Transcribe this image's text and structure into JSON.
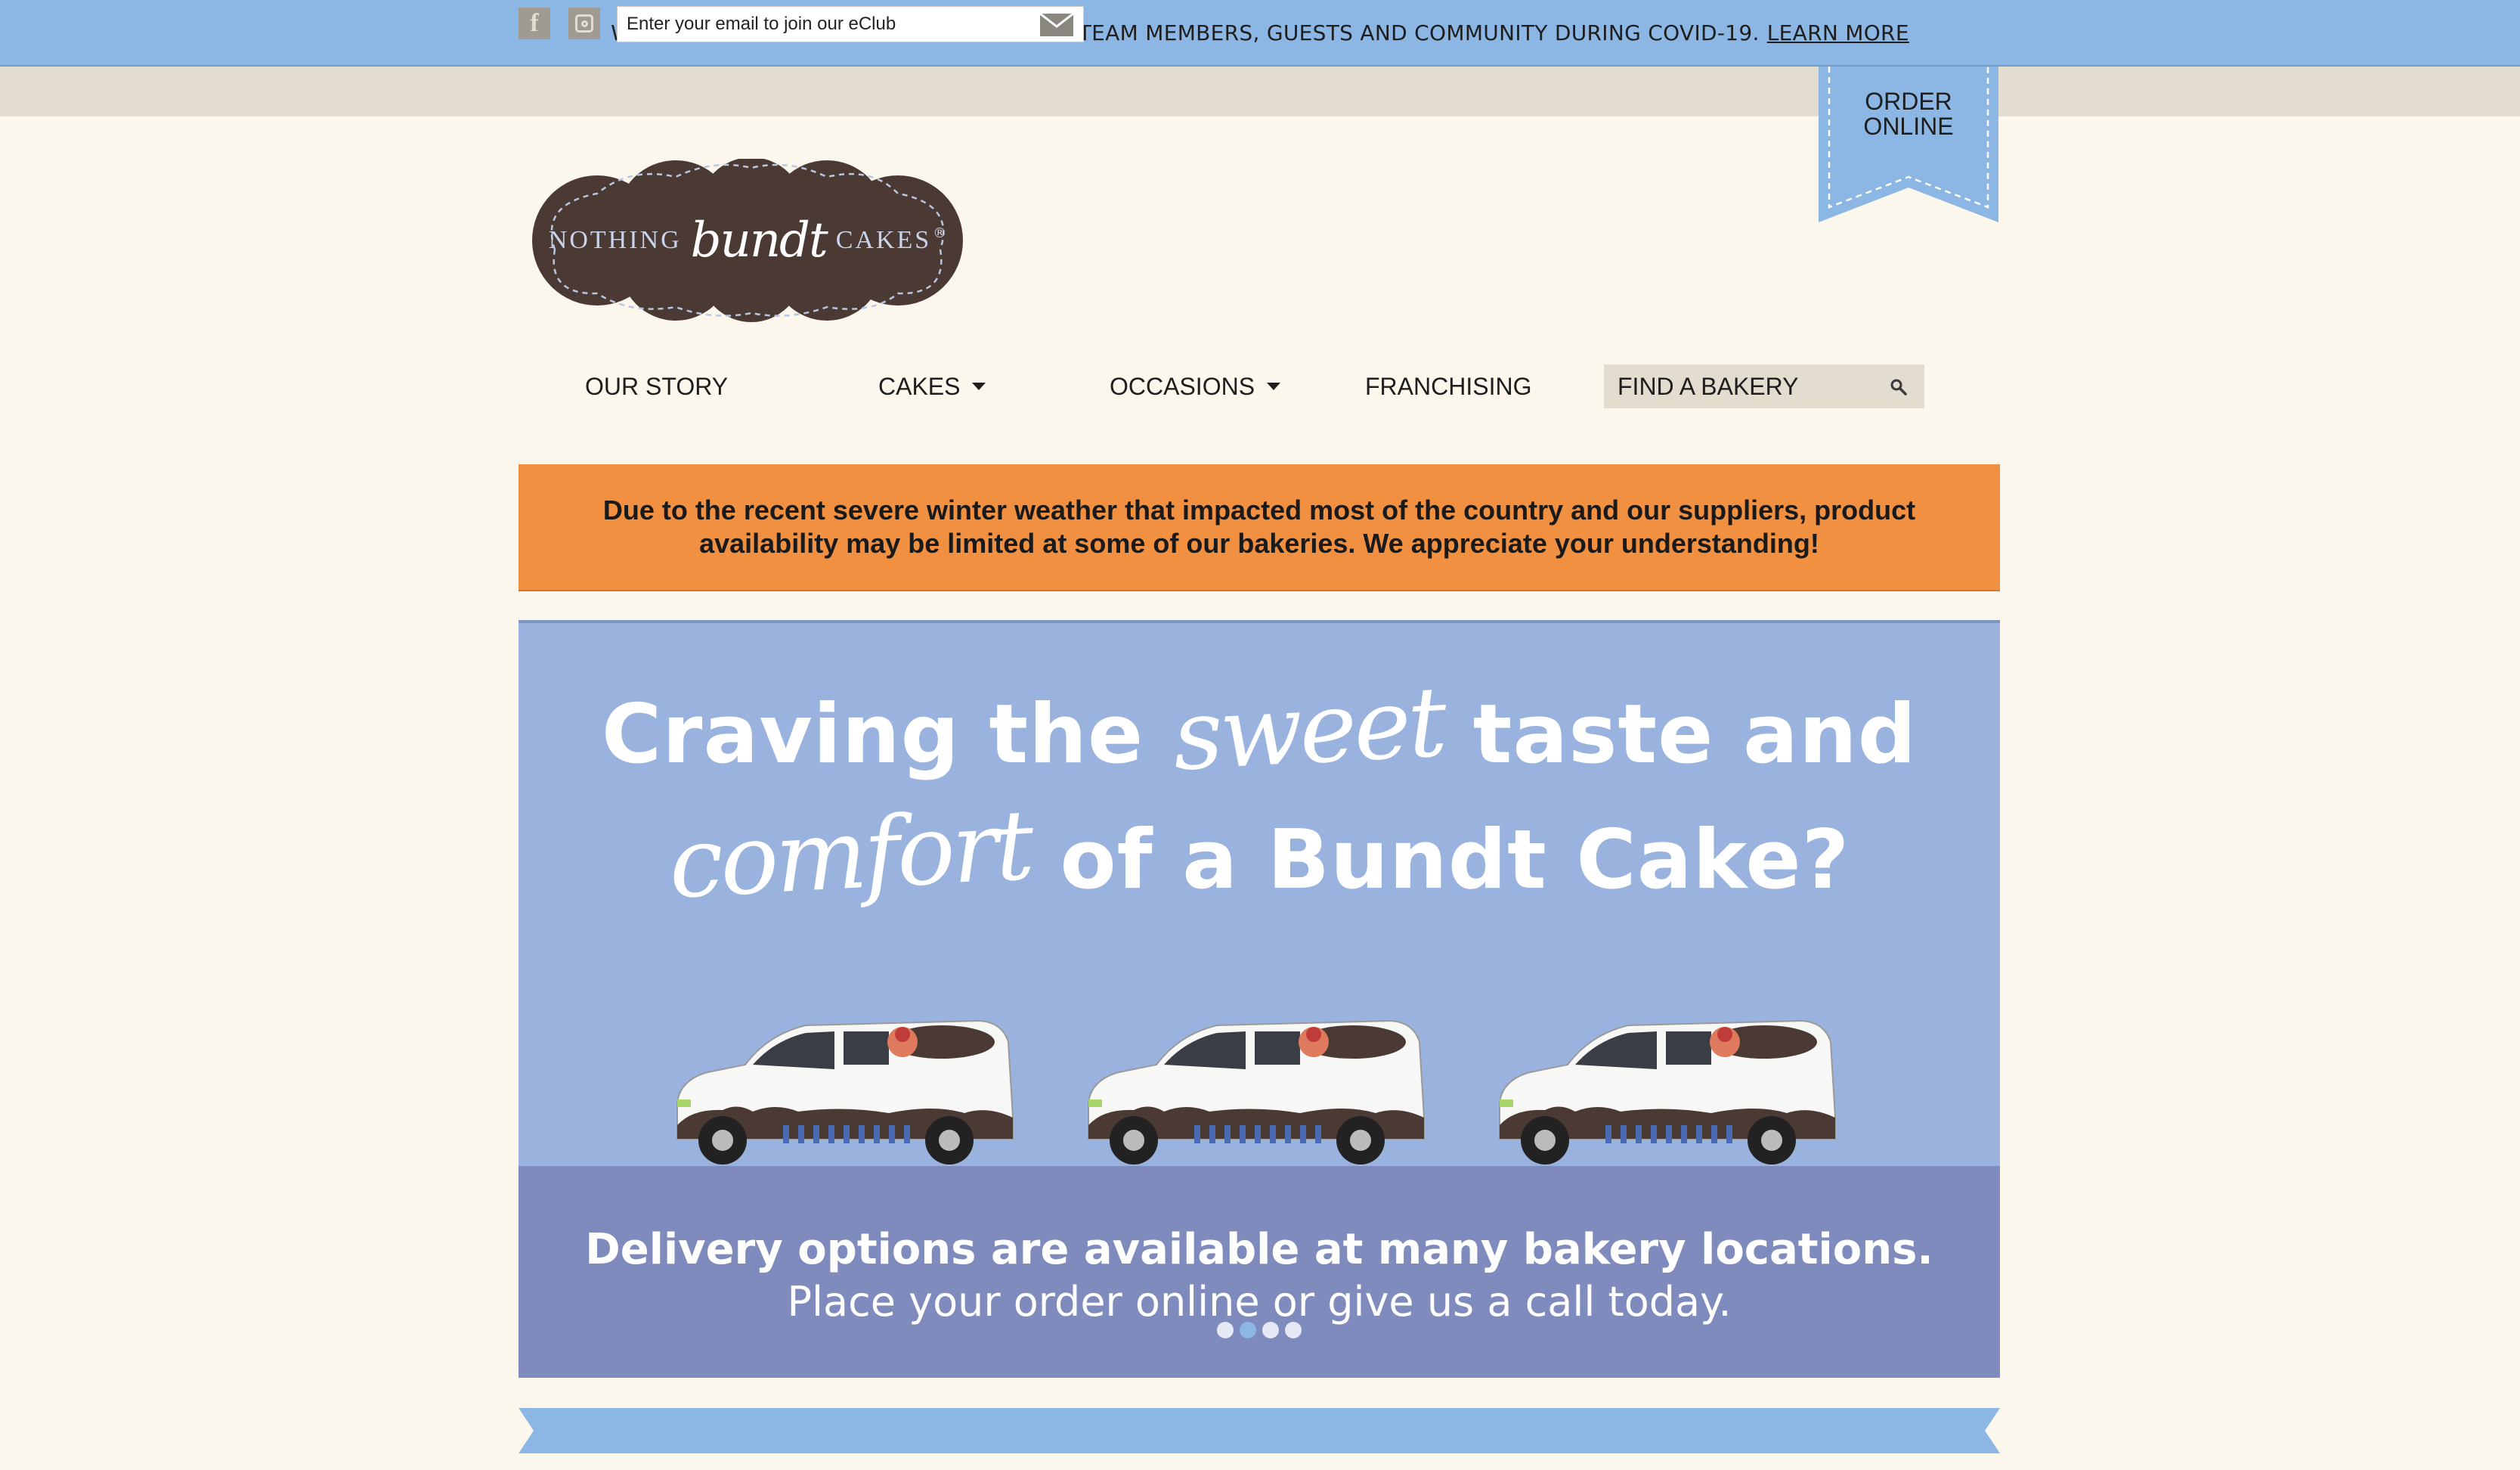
{
  "covid_banner": {
    "text": "WE ARE COMMITTED TO PROTECTING OUR TEAM MEMBERS, GUESTS AND COMMUNITY DURING COVID-19.",
    "link_text": "LEARN MORE"
  },
  "utility": {
    "social_icons": [
      "facebook-icon",
      "instagram-icon"
    ],
    "eclub_placeholder": "Enter your email to join our eClub",
    "submit_icon": "mail-icon"
  },
  "order_online": {
    "line1": "ORDER",
    "line2": "ONLINE"
  },
  "logo": {
    "word1": "NOTHING",
    "word2": "bundt",
    "word3": "CAKES",
    "mark": "®"
  },
  "nav": {
    "items": [
      {
        "label": "OUR STORY",
        "has_dropdown": false
      },
      {
        "label": "CAKES",
        "has_dropdown": true
      },
      {
        "label": "OCCASIONS",
        "has_dropdown": true
      },
      {
        "label": "FRANCHISING",
        "has_dropdown": false
      }
    ],
    "find_bakery_placeholder": "FIND A BAKERY",
    "find_bakery_icon": "search-icon"
  },
  "alert": {
    "text": "Due to the recent severe winter weather that impacted most of the country and our suppliers, product availability may be limited at some of our bakeries. We appreciate your understanding!"
  },
  "hero": {
    "line1_a": "Craving the",
    "line1_script": "sweet",
    "line1_b": "taste and",
    "line2_script": "comfort",
    "line2_b": "of a Bundt Cake?",
    "sub_bold": "Delivery options are available at many bakery locations.",
    "sub_regular": "Place your order online or give us a call today.",
    "slide_count": 4,
    "active_slide": 2
  },
  "colors": {
    "covid_bar": "#8cb6e3",
    "page_bg": "#fbf7ed",
    "utility_bar": "#e3ddd0",
    "alert_bg": "#f09040",
    "hero_bg": "#99b2de",
    "hero_band": "#7f8bbd",
    "logo_brown": "#4b3a33"
  }
}
